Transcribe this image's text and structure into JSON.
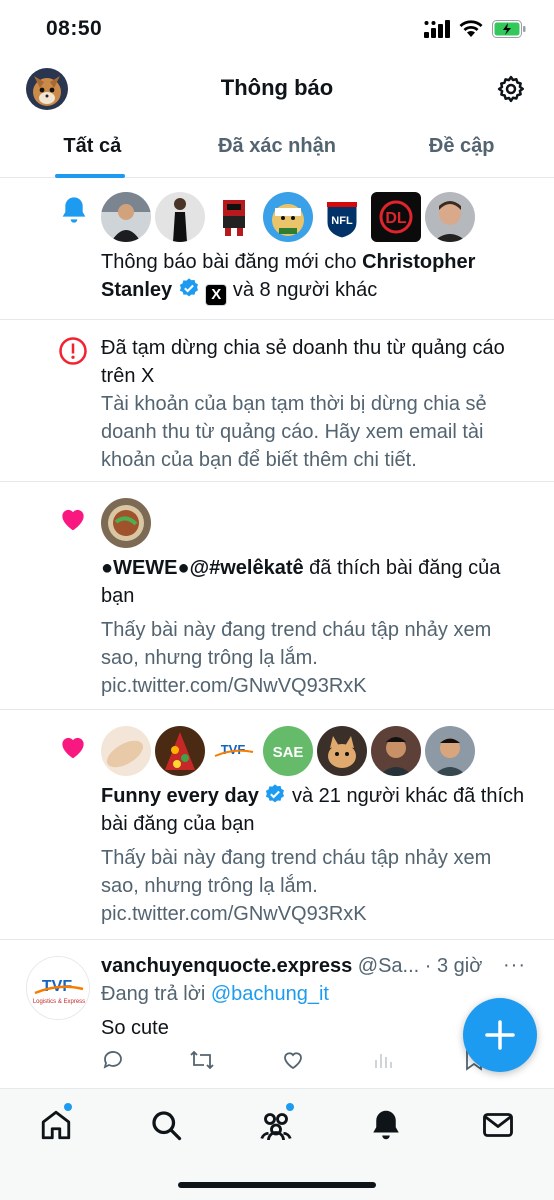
{
  "status_bar": {
    "time": "08:50"
  },
  "header": {
    "title": "Thông báo"
  },
  "tabs": [
    {
      "label": "Tất cả",
      "active": true
    },
    {
      "label": "Đã xác nhận",
      "active": false
    },
    {
      "label": "Đề cập",
      "active": false
    }
  ],
  "notifications": [
    {
      "type": "new-post",
      "icon": "bell-icon",
      "avatars": [
        "man-avatar",
        "woman-avatar",
        "pixel-robot-avatar",
        "doge-avatar",
        "nfl-avatar",
        "dl-avatar",
        "elon-avatar"
      ],
      "text_prefix": "Thông báo bài đăng mới cho ",
      "name": "Christopher Stanley",
      "x_badge": "X",
      "text_suffix": " và 8 người khác"
    },
    {
      "type": "alert",
      "icon": "alert-circle-icon",
      "title": "Đã tạm dừng chia sẻ doanh thu từ quảng cáo trên X",
      "body": "Tài khoản của bạn tạm thời bị dừng chia sẻ doanh thu từ quảng cáo. Hãy xem email tài khoản của bạn để biết thêm chi tiết."
    },
    {
      "type": "like",
      "icon": "heart-icon",
      "avatars": [
        "food-avatar"
      ],
      "name": "●WEWE●@#welêkatê",
      "text_suffix": " đã thích bài đăng của bạn",
      "preview": "Thấy bài này đang trend cháu tập nhảy xem sao, nhưng trông lạ lắm. pic.twitter.com/GNwVQ93RxK"
    },
    {
      "type": "like",
      "icon": "heart-icon",
      "avatars": [
        "skin-avatar",
        "fruit-avatar",
        "tvf-logo-avatar",
        "sae-avatar",
        "cat-avatar",
        "man2-avatar",
        "man3-avatar"
      ],
      "name": "Funny every day",
      "text_suffix": " và 21 người khác đã thích bài đăng của bạn",
      "preview": "Thấy bài này đang trend cháu tập nhảy xem sao, nhưng trông lạ lắm. pic.twitter.com/GNwVQ93RxK"
    }
  ],
  "tweet": {
    "display_name": "vanchuyenquocte.express",
    "handle": "@Sa...",
    "time": "· 3 giờ",
    "more": "···",
    "replying_prefix": "Đang trả lời ",
    "replying_to": "@bachung_it",
    "text": "So cute",
    "avatar_text": "TVF",
    "avatar_sub": "Logistics & Express"
  },
  "sae_label": "SAE",
  "nfl_label": "NFL",
  "dl_label": "DL",
  "fab_icon": "plus-icon",
  "colors": {
    "accent": "#1d9bf0",
    "like": "#f91880",
    "alert": "#f4212e",
    "text": "#0f1419",
    "secondary": "#536471"
  },
  "bottom_nav": [
    "home-icon",
    "search-icon",
    "communities-icon",
    "notifications-icon",
    "messages-icon"
  ]
}
